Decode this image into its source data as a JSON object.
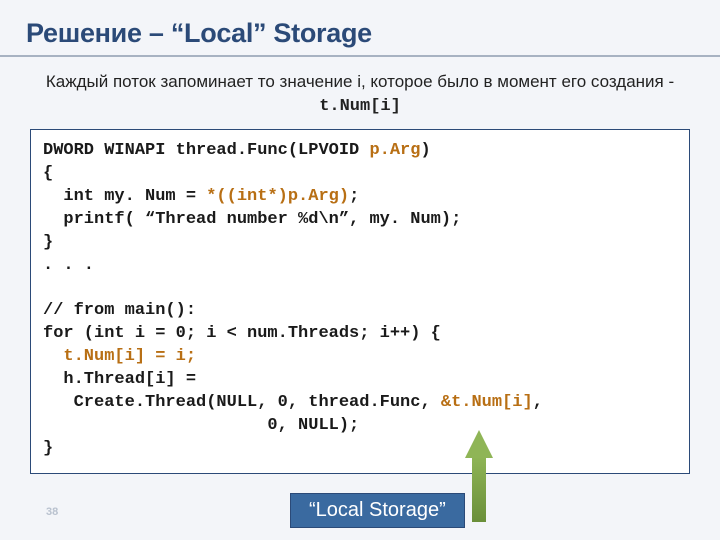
{
  "title": "Решение – “Local” Storage",
  "subtitle_prefix": "Каждый поток запоминает то значение i, которое было в момент его создания - ",
  "subtitle_code": "t.Num[i]",
  "code": {
    "l1a": "DWORD WINAPI thread.Func(LPVOID ",
    "l1b": "p.Arg",
    "l1c": ")",
    "l2": "{",
    "l3a": "  int my. Num = ",
    "l3b": "*((int*)p.Arg)",
    "l3c": ";",
    "l4": "  printf( “Thread number %d\\n”, my. Num);",
    "l5": "}",
    "l6": ". . .",
    "l7": "",
    "l8": "// from main():",
    "l9": "for (int i = 0; i < num.Threads; i++) {",
    "l10a": "  ",
    "l10b": "t.Num[i] = i;",
    "l11": "  h.Thread[i] =",
    "l12a": "   Create.Thread(NULL, 0, thread.Func, ",
    "l12b": "&t.Num[i]",
    "l12c": ",",
    "l13": "                      0, NULL);",
    "l14": "}"
  },
  "callout": "“Local Storage”",
  "page_number": "38"
}
